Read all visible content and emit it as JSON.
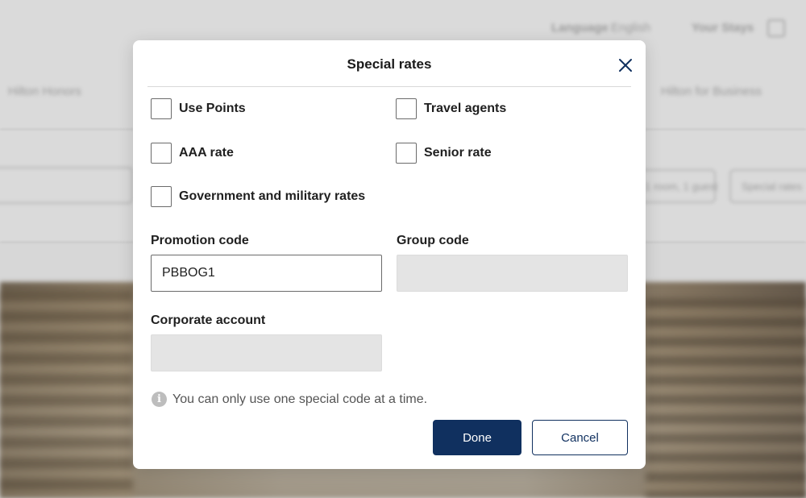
{
  "background": {
    "language_label": "Language",
    "language_value": "English",
    "your_stays": "Your Stays",
    "honors": "Hilton Honors",
    "business": "Hilton for Business",
    "rooms_guests": "1 room, 1 guest",
    "special_rates_pill": "Special rates"
  },
  "modal": {
    "title": "Special rates",
    "close_icon": "close-icon",
    "checkboxes": [
      {
        "label": "Use Points",
        "checked": false
      },
      {
        "label": "Travel agents",
        "checked": false
      },
      {
        "label": "AAA rate",
        "checked": false
      },
      {
        "label": "Senior rate",
        "checked": false
      },
      {
        "label": "Government and military rates",
        "checked": false
      }
    ],
    "promotion_code": {
      "label": "Promotion code",
      "value": "PBBOG1"
    },
    "group_code": {
      "label": "Group code",
      "value": ""
    },
    "corporate_account": {
      "label": "Corporate account",
      "value": ""
    },
    "info_icon": "info-icon",
    "info_text": "You can only use one special code at a time.",
    "done_label": "Done",
    "cancel_label": "Cancel"
  },
  "colors": {
    "primary": "#10305f",
    "overlay_gray": "#d7d7d7",
    "disabled_field": "#e4e4e4"
  }
}
